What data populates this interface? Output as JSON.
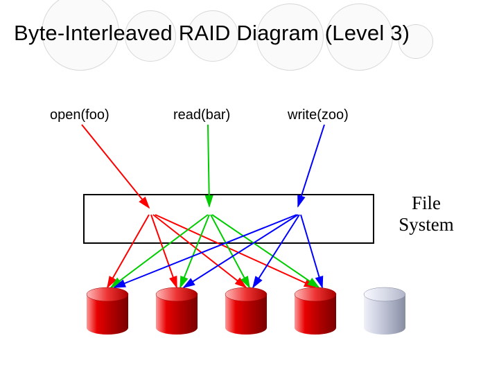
{
  "title": "Byte-Interleaved RAID Diagram (Level 3)",
  "operations": {
    "open": "open(foo)",
    "read": "read(bar)",
    "write": "write(zoo)"
  },
  "fs_label_line1": "File",
  "fs_label_line2": "System",
  "colors": {
    "open": "#ff0000",
    "read": "#00cc00",
    "write": "#0000ff",
    "data_disk": "#cc0000",
    "parity_disk": "#c0c4d8"
  },
  "disks": {
    "count": 5,
    "data_count": 4,
    "parity_count": 1
  }
}
